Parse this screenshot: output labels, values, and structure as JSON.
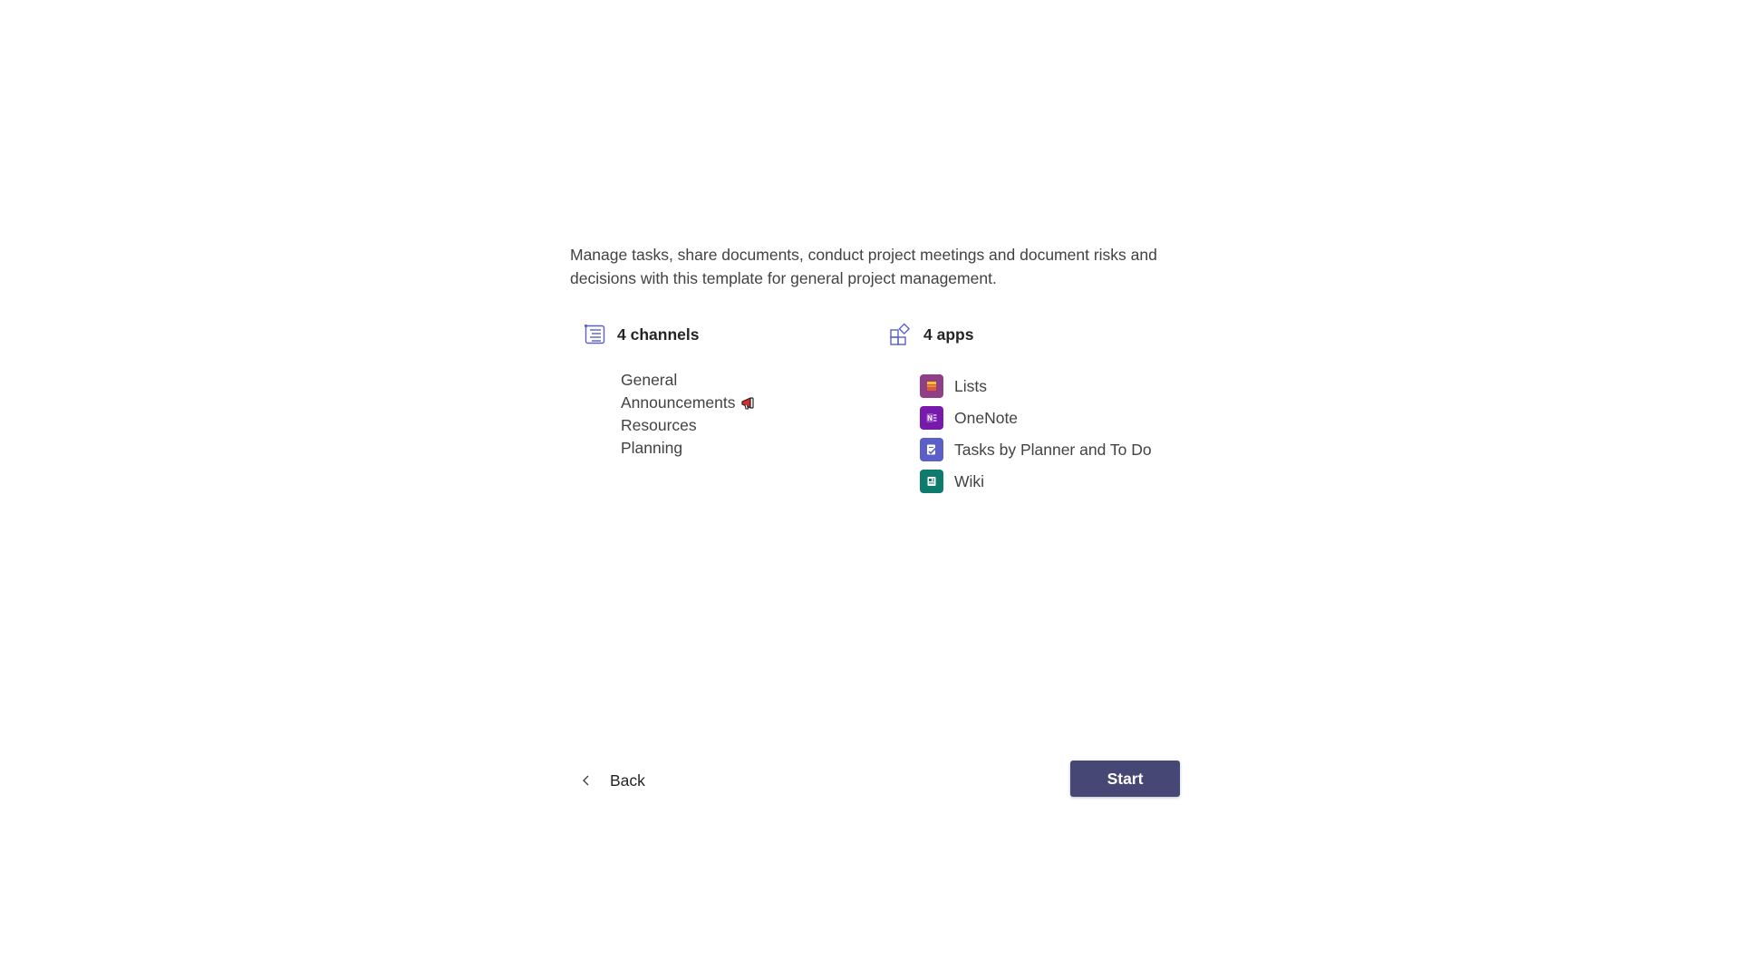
{
  "description": "Manage tasks, share documents, conduct project meetings and document risks and decisions with this template for general project management.",
  "channels": {
    "title": "4 channels",
    "icon": "channel-list-icon",
    "items": [
      {
        "label": "General"
      },
      {
        "label": "Announcements",
        "badge_icon": "megaphone-icon"
      },
      {
        "label": "Resources"
      },
      {
        "label": "Planning"
      }
    ]
  },
  "apps": {
    "title": "4 apps",
    "icon": "apps-icon",
    "items": [
      {
        "label": "Lists",
        "icon": "lists-icon",
        "color": "#8f3f88"
      },
      {
        "label": "OneNote",
        "icon": "onenote-icon",
        "color": "#7719aa"
      },
      {
        "label": "Tasks by Planner and To Do",
        "icon": "planner-icon",
        "color": "#5b5fc7"
      },
      {
        "label": "Wiki",
        "icon": "wiki-icon",
        "color": "#0f7b6c"
      }
    ]
  },
  "footer": {
    "back_label": "Back",
    "start_label": "Start"
  },
  "colors": {
    "primary": "#464775",
    "text": "#242424",
    "secondary_text": "#424242"
  }
}
